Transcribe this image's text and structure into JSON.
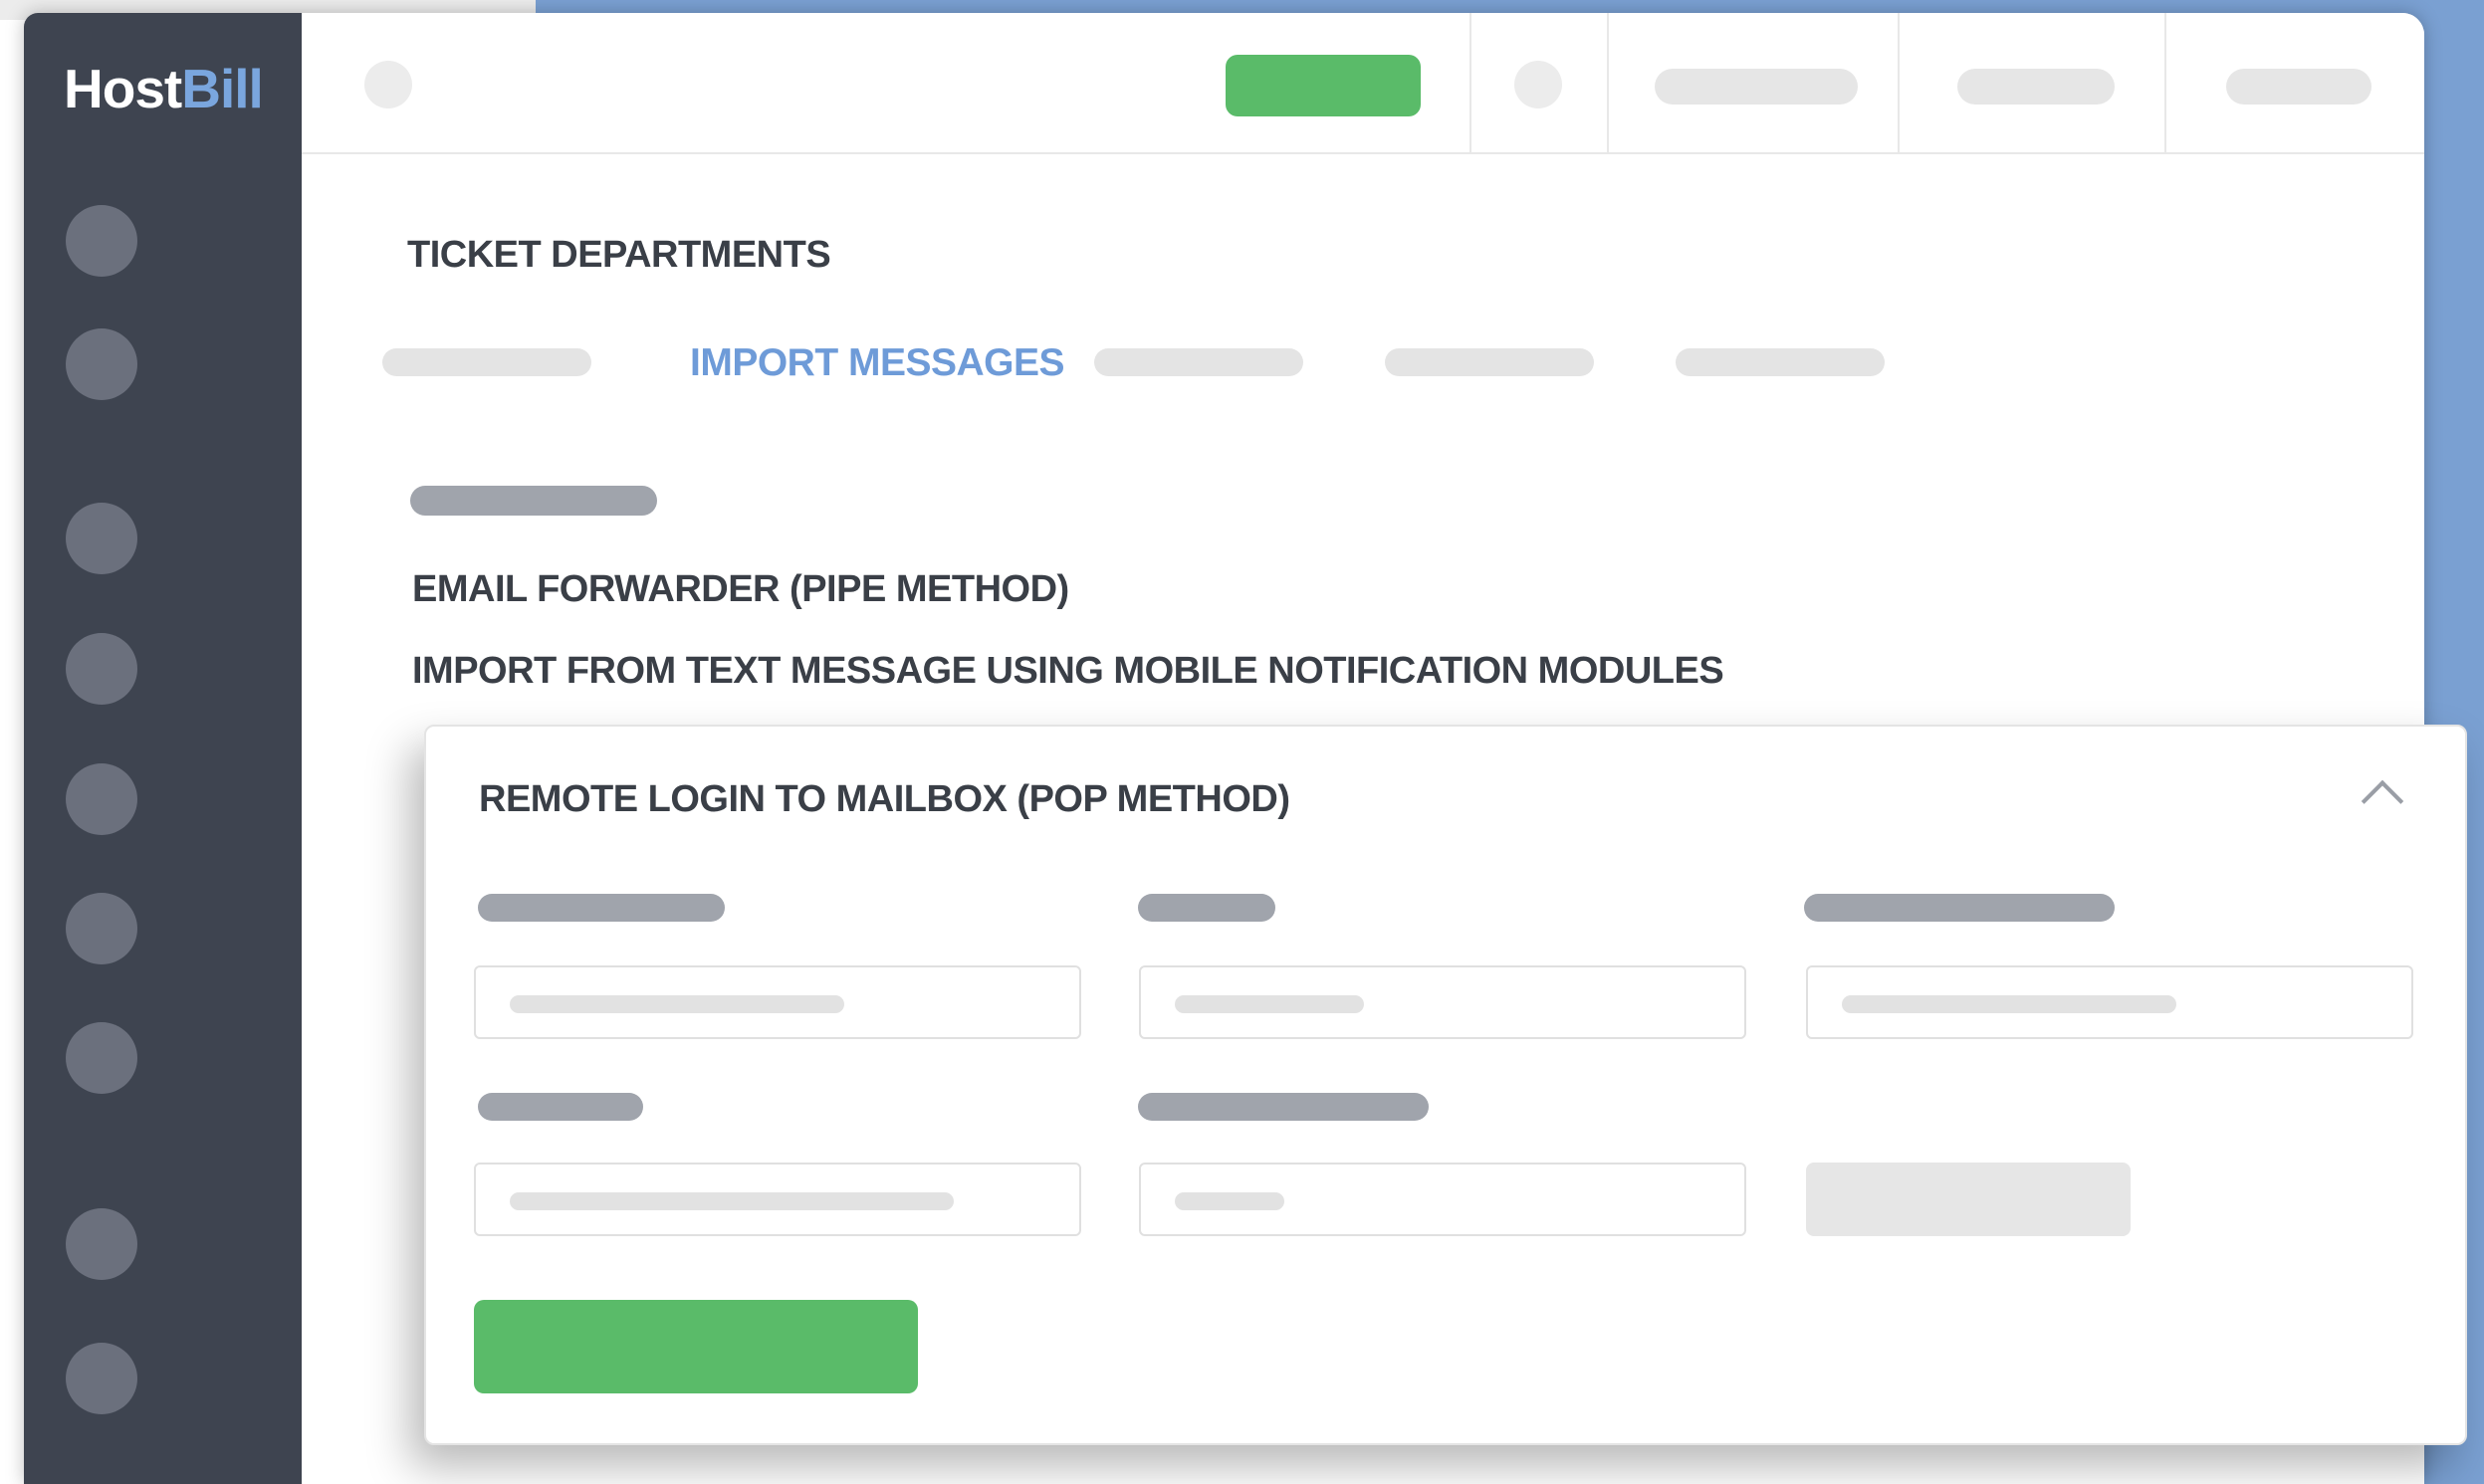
{
  "app": {
    "logo_host": "Host",
    "logo_bill": "Bill",
    "accent_color": "#6e9bd8",
    "primary_button_color": "#5abb69",
    "sidebar_color": "#3e4450"
  },
  "page": {
    "title": "TICKET DEPARTMENTS",
    "active_tab": "IMPORT MESSAGES"
  },
  "import_methods": {
    "pipe": "EMAIL FORWARDER (PIPE METHOD)",
    "sms": "IMPORT FROM TEXT MESSAGE USING MOBILE NOTIFICATION MODULES",
    "pop": "REMOTE LOGIN TO MAILBOX (POP METHOD)"
  }
}
